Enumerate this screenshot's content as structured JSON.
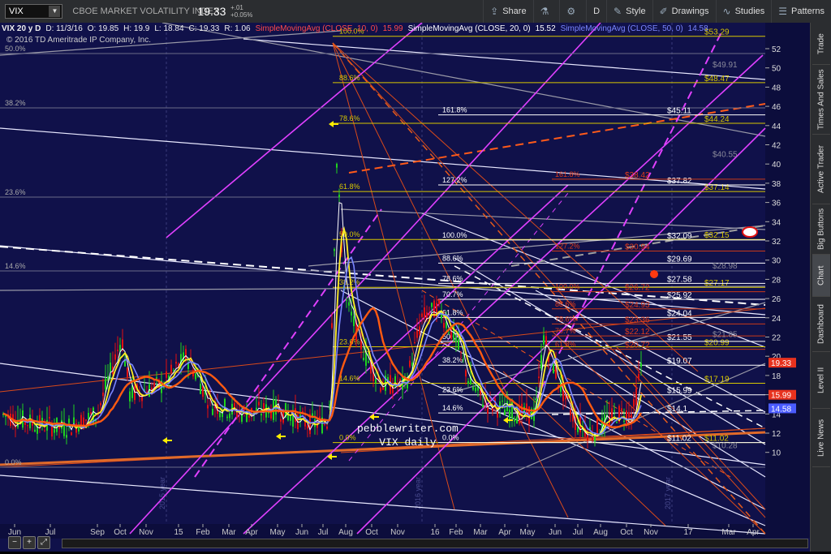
{
  "toolbar": {
    "symbol": "VIX",
    "title": "CBOE MARKET VOLATILITY INDEX",
    "last": "19.33",
    "change": "+.01",
    "change_pct": "+0.05%",
    "share": "Share",
    "period": "D",
    "style": "Style",
    "drawings": "Drawings",
    "studies": "Studies",
    "patterns": "Patterns"
  },
  "header": {
    "desc": "VIX 20 y D",
    "date": "D: 11/3/16",
    "open": "O: 19.85",
    "high": "H: 19.9",
    "low": "L: 18.84",
    "close": "C: 19.33",
    "range": "R: 1.06",
    "sma10": "SimpleMovingAvg (CLOSE, 10, 0)",
    "sma10_val": "15.99",
    "sma20": "SimpleMovingAvg (CLOSE, 20, 0)",
    "sma20_val": "15.52",
    "sma50": "SimpleMovingAvg (CLOSE, 50, 0)",
    "sma50_val": "14.58",
    "copyright": "© 2016 TD Ameritrade IP Company, Inc."
  },
  "watermark": {
    "line1": "pebblewriter.com",
    "line2": "VIX daily"
  },
  "price_axis": {
    "ticks": [
      "52",
      "50",
      "48",
      "46",
      "44",
      "42",
      "40",
      "38",
      "36",
      "34",
      "32",
      "30",
      "28",
      "26",
      "24",
      "22",
      "20",
      "18",
      "16",
      "14",
      "12",
      "10"
    ],
    "tags": [
      {
        "label": "19.33",
        "color": "#e8321e"
      },
      {
        "label": "15.99",
        "color": "#e8321e"
      },
      {
        "label": "14.58",
        "color": "#4a5bff"
      }
    ]
  },
  "time_axis": [
    "Jun",
    "Jul",
    "Sep",
    "Oct",
    "Nov",
    "15",
    "Feb",
    "Mar",
    "Apr",
    "May",
    "Jun",
    "Jul",
    "Aug",
    "Oct",
    "Nov",
    "16",
    "Feb",
    "Mar",
    "Apr",
    "May",
    "Jun",
    "Jul",
    "Aug",
    "Oct",
    "Nov",
    "17",
    "Mar",
    "Apr"
  ],
  "year_marks": [
    "2015 year",
    "2016 year",
    "2017 year"
  ],
  "left_fib_labels": [
    "50.0%",
    "38.2%",
    "23.6%",
    "14.6%",
    "0.0%"
  ],
  "main_fib": {
    "pct": [
      "100.0%",
      "88.6%",
      "78.6%",
      "61.8%",
      "50.0%",
      "38.2%",
      "23.6%",
      "14.6%",
      "0.0%"
    ],
    "prices": [
      "$53.29",
      "$48.47",
      "$44.24",
      "$37.14",
      "$32.15",
      "$27.17",
      "$20.99",
      "$17.19",
      "$11.02"
    ]
  },
  "mid_fib": {
    "pct": [
      "161.8%",
      "127.2%",
      "100.0%",
      "88.6%",
      "78.6%",
      "70.7%",
      "61.8%",
      "50.0%",
      "38.2%",
      "23.6%",
      "14.6%",
      "0.0%"
    ],
    "prices": [
      "$45.11",
      "$37.82",
      "$32.09",
      "$29.69",
      "$27.58",
      "$25.92",
      "$24.04",
      "$21.55",
      "$19.07",
      "$15.99",
      "$14.1",
      "$11.02"
    ]
  },
  "red_fib": {
    "pct": [
      "161.8%",
      "127.2%",
      "100.0%",
      "88.6%",
      "78.6%",
      "70.7%",
      "61.8%",
      "50.0%"
    ],
    "prices": [
      "$38.42",
      "$30.94",
      "$26.72",
      "$24.93",
      "$23.36",
      "$22.12",
      "$20.72"
    ]
  },
  "gray_prices": [
    "$49.91",
    "$40.55",
    "$28.98",
    "$21.85",
    "$10.28"
  ],
  "sidebar": [
    "Trade",
    "Times And Sales",
    "Active Trader",
    "Big Buttons",
    "Chart",
    "Dashboard",
    "Level II",
    "Live News"
  ],
  "colors": {
    "bg": "#10114a",
    "fib_gold": "#d8c800",
    "sma10": "#ff3a1a",
    "sma20": "#ffffff",
    "sma50": "#7a86ff",
    "magenta": "#e040ff",
    "up": "#1fd21f",
    "down": "#e01010"
  }
}
